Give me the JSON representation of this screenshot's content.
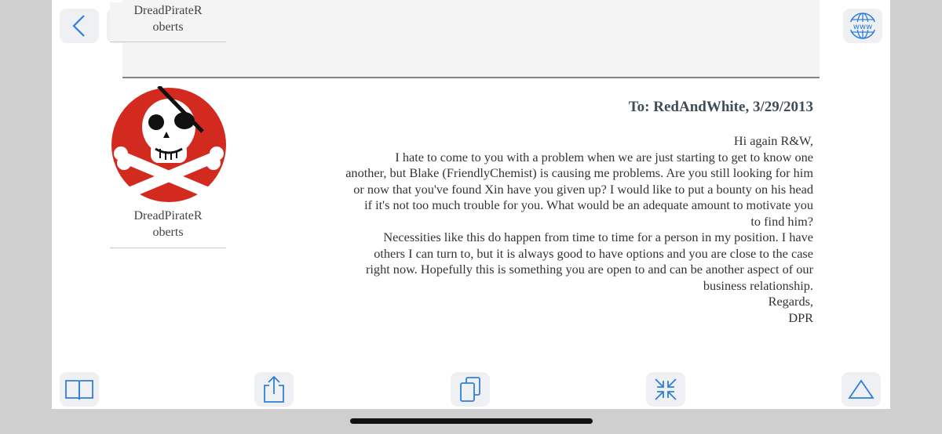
{
  "nav": {
    "sender_top_line1": "DreadPirateR",
    "sender_top_line2": "oberts"
  },
  "sender": {
    "name_line1": "DreadPirateR",
    "name_line2": "oberts",
    "avatar_icon": "pirate-skull-crossbones-icon"
  },
  "message": {
    "header": "To: RedAndWhite, 3/29/2013",
    "lines": [
      "Hi again R&W,",
      "I hate to come to you with a problem when we are just starting to get to know one",
      "another, but Blake (FriendlyChemist) is causing me problems. Are you still looking for him",
      "or now that you've found Xin have you given up? I would like to put a bounty on his head",
      "if it's not too much trouble for you. What would be an adequate amount to motivate you",
      "to find him?",
      "Necessities like this do happen from time to time for a person in my position. I have",
      "others I can turn to, but it is always good to have options and you are close to the case",
      "right now. Hopefully this is something you are open to and can be another aspect of our",
      "business relationship.",
      "Regards,",
      "DPR"
    ]
  },
  "toolbar": {
    "icons": [
      "back-icon",
      "forward-icon",
      "globe-www-icon",
      "book-icon",
      "share-icon",
      "copy-icon",
      "collapse-icon",
      "scroll-top-icon"
    ]
  },
  "colors": {
    "accent": "#2f7fd9",
    "button_bg": "#eef0f3",
    "header_text": "#3f4d56",
    "pirate_red": "#d32a1f"
  }
}
